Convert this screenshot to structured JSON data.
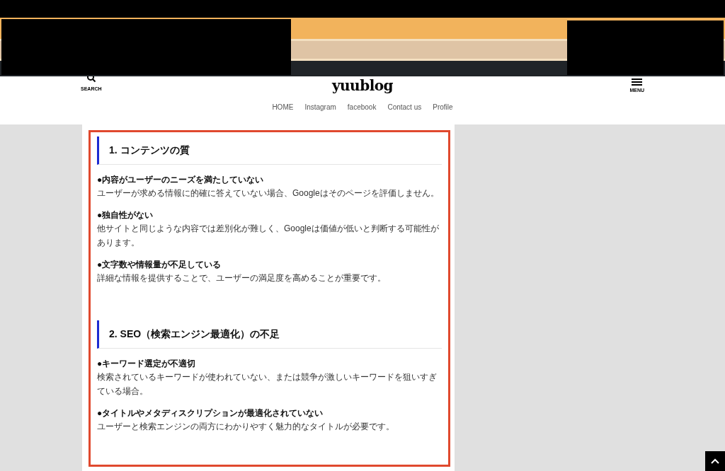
{
  "header": {
    "search_label": "SEARCH",
    "site_title": "yuublog",
    "menu_label": "MENU"
  },
  "nav": [
    "HOME",
    "Instagram",
    "facebook",
    "Contact us",
    "Profile"
  ],
  "sections": [
    {
      "heading": "1. コンテンツの質",
      "items": [
        {
          "title": "●内容がユーザーのニーズを満たしていない",
          "body": "ユーザーが求める情報に的確に答えていない場合、Googleはそのページを評価しません。"
        },
        {
          "title": "●独自性がない",
          "body": "他サイトと同じような内容では差別化が難しく、Googleは価値が低いと判断する可能性があります。"
        },
        {
          "title": "●文字数や情報量が不足している",
          "body": "詳細な情報を提供することで、ユーザーの満足度を高めることが重要です。"
        }
      ]
    },
    {
      "heading": "2. SEO（検索エンジン最適化）の不足",
      "items": [
        {
          "title": "●キーワード選定が不適切",
          "body": "検索されているキーワードが使われていない、または競争が激しいキーワードを狙いすぎている場合。"
        },
        {
          "title": "●タイトルやメタディスクリプションが最適化されていない",
          "body": "ユーザーと検索エンジンの両方にわかりやすく魅力的なタイトルが必要です。"
        }
      ]
    }
  ]
}
